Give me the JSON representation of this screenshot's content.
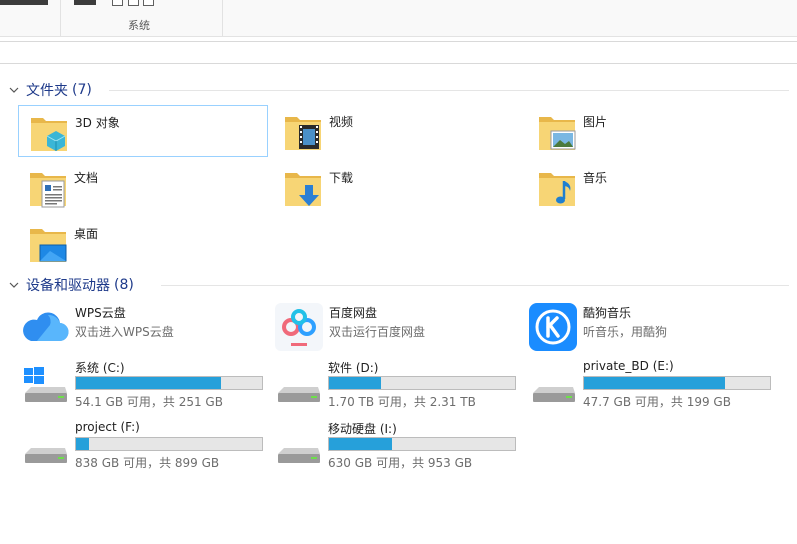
{
  "ribbon": {
    "group_label": "系统"
  },
  "sections": {
    "folders": {
      "title": "文件夹",
      "count": "(7)"
    },
    "devices": {
      "title": "设备和驱动器",
      "count": "(8)"
    }
  },
  "folders": [
    {
      "name": "3D 对象",
      "icon": "3d-objects-folder-icon",
      "selected": true
    },
    {
      "name": "视频",
      "icon": "videos-folder-icon"
    },
    {
      "name": "图片",
      "icon": "pictures-folder-icon"
    },
    {
      "name": "文档",
      "icon": "documents-folder-icon"
    },
    {
      "name": "下载",
      "icon": "downloads-folder-icon"
    },
    {
      "name": "音乐",
      "icon": "music-folder-icon"
    },
    {
      "name": "桌面",
      "icon": "desktop-folder-icon"
    }
  ],
  "apps": [
    {
      "name": "WPS云盘",
      "subtitle": "双击进入WPS云盘",
      "icon": "wps-cloud-icon"
    },
    {
      "name": "百度网盘",
      "subtitle": "双击运行百度网盘",
      "icon": "baidu-netdisk-icon"
    },
    {
      "name": "酷狗音乐",
      "subtitle": "听音乐，用酷狗",
      "icon": "kugou-music-icon"
    }
  ],
  "drives": [
    {
      "name": "系统 (C:)",
      "free": "54.1 GB 可用，共 251 GB",
      "used_fraction": 0.78,
      "icon": "windows-drive-icon"
    },
    {
      "name": "软件 (D:)",
      "free": "1.70 TB 可用，共 2.31 TB",
      "used_fraction": 0.28,
      "icon": "hard-drive-icon"
    },
    {
      "name": "private_BD (E:)",
      "free": "47.7 GB 可用，共 199 GB",
      "used_fraction": 0.76,
      "icon": "hard-drive-icon"
    },
    {
      "name": "project (F:)",
      "free": "838 GB 可用，共 899 GB",
      "used_fraction": 0.07,
      "icon": "hard-drive-icon"
    },
    {
      "name": "移动硬盘 (I:)",
      "free": "630 GB 可用，共 953 GB",
      "used_fraction": 0.34,
      "icon": "hard-drive-icon"
    }
  ],
  "colors": {
    "bar_fill": "#26a0da",
    "section_title": "#1e3a8a",
    "selection_border": "#99d1ff"
  }
}
